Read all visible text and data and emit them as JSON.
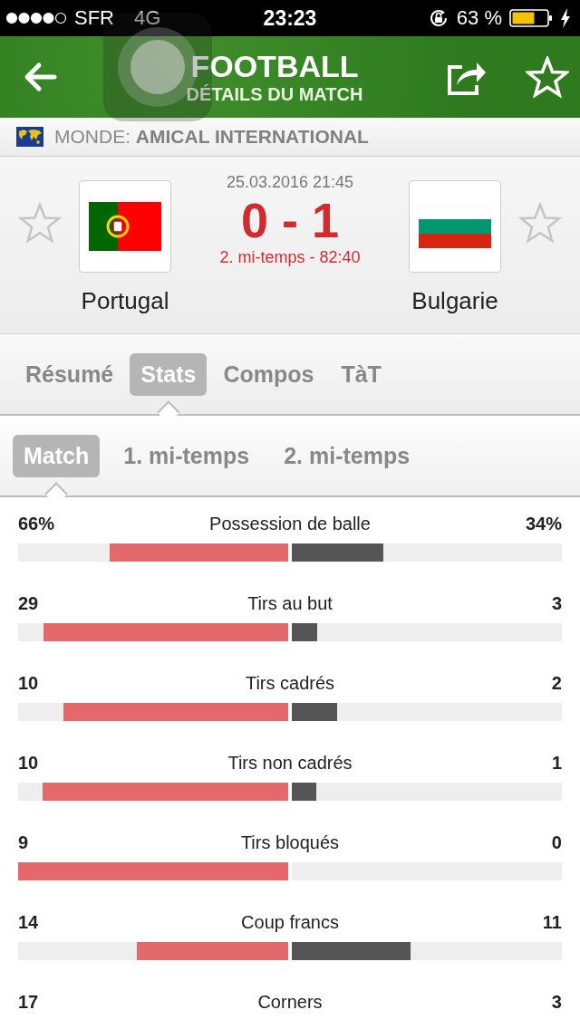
{
  "status_bar": {
    "carrier": "SFR",
    "network": "4G",
    "time": "23:23",
    "battery": "63 %"
  },
  "header": {
    "title": "FOOTBALL",
    "subtitle": "DÉTAILS DU MATCH"
  },
  "league": {
    "region": "MONDE:",
    "name": "AMICAL INTERNATIONAL"
  },
  "match": {
    "datetime": "25.03.2016 21:45",
    "score": "0 - 1",
    "period": "2. mi-temps - 82:40",
    "home": {
      "name": "Portugal",
      "kind": "portugal"
    },
    "away": {
      "name": "Bulgarie",
      "kind": "bulgaria"
    }
  },
  "tabs": [
    {
      "label": "Résumé",
      "selected": false
    },
    {
      "label": "Stats",
      "selected": true
    },
    {
      "label": "Compos",
      "selected": false
    },
    {
      "label": "TàT",
      "selected": false
    }
  ],
  "period_tabs": [
    {
      "label": "Match",
      "selected": true
    },
    {
      "label": "1. mi-temps",
      "selected": false
    },
    {
      "label": "2. mi-temps",
      "selected": false
    }
  ],
  "stats": [
    {
      "name": "Possession de balle",
      "home": {
        "value": "66%",
        "level": 0.66
      },
      "away": {
        "value": "34%",
        "level": 0.34
      }
    },
    {
      "name": "Tirs au but",
      "home": {
        "value": "29",
        "level": 0.906
      },
      "away": {
        "value": "3",
        "level": 0.094
      }
    },
    {
      "name": "Tirs cadrés",
      "home": {
        "value": "10",
        "level": 0.833
      },
      "away": {
        "value": "2",
        "level": 0.167
      }
    },
    {
      "name": "Tirs non cadrés",
      "home": {
        "value": "10",
        "level": 0.909
      },
      "away": {
        "value": "1",
        "level": 0.091
      }
    },
    {
      "name": "Tirs bloqués",
      "home": {
        "value": "9",
        "level": 1
      },
      "away": {
        "value": "0"
      }
    },
    {
      "name": "Coup francs",
      "home": {
        "value": "14",
        "level": 0.56
      },
      "away": {
        "value": "11",
        "level": 0.44
      }
    },
    {
      "name": "Corners",
      "home": {
        "value": "17"
      },
      "away": {
        "value": "3"
      }
    }
  ]
}
